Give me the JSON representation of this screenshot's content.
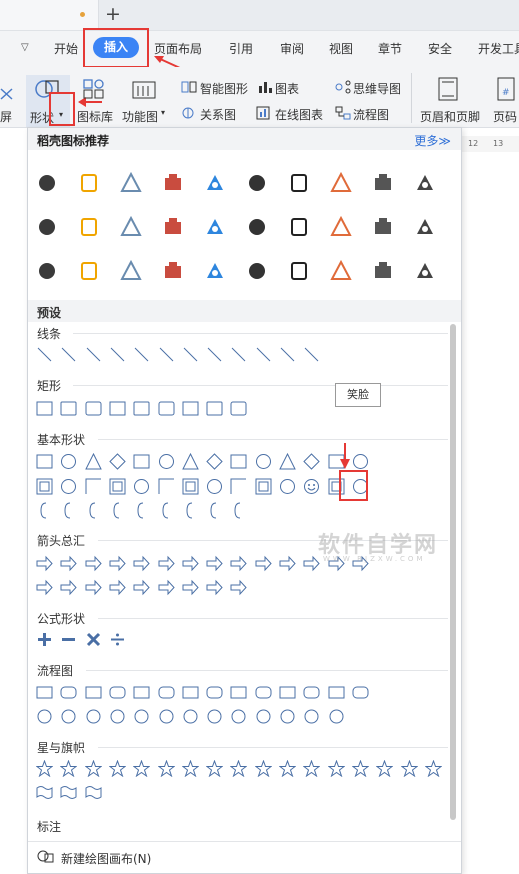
{
  "tabs": {
    "new_tab": "+"
  },
  "menu": {
    "items": [
      "开始",
      "插入",
      "页面布局",
      "引用",
      "审阅",
      "视图",
      "章节",
      "安全",
      "开发工具"
    ],
    "active": "插入",
    "dropdown": "▽",
    "accent": "#3b84f5"
  },
  "ribbon": {
    "left_cut": "屏",
    "shapes": "形状",
    "icon_lib": "图标库",
    "function_chart": "功能图",
    "smart_graphic": "智能图形",
    "chart": "图表",
    "mind_map": "思维导图",
    "relation": "关系图",
    "online_chart": "在线图表",
    "flowchart": "流程图",
    "header_footer": "页眉和页脚",
    "page_num": "页码"
  },
  "ruler": {
    "ticks": [
      "12",
      "13"
    ]
  },
  "panel": {
    "title": "稻壳图标推荐",
    "more": "更多≫",
    "recommended_icons": [
      "pushpin-icon",
      "pie-chart-icon",
      "flag-icon",
      "lightbulb-icon",
      "pen-icon",
      "trophy-icon",
      "document-icon",
      "clipboard-icon",
      "users-icon",
      "camera-icon",
      "money-icon",
      "sneaker-icon",
      "cloud-icon",
      "building-icon",
      "badge-icon",
      "hexagon-icon",
      "contact-icon",
      "gear-icon",
      "shopping-bag-icon",
      "edit-note-icon",
      "hourglass-icon",
      "sale-tag-icon",
      "board-icon",
      "tree-icon",
      "search-doc-icon",
      "cake-icon",
      "crab-icon",
      "person-icon",
      "stats-icon",
      "house-icon"
    ],
    "presets_title": "预设",
    "sections": [
      {
        "title": "线条"
      },
      {
        "title": "矩形"
      },
      {
        "title": "基本形状"
      },
      {
        "title": "箭头总汇"
      },
      {
        "title": "公式形状"
      },
      {
        "title": "流程图"
      },
      {
        "title": "星与旗帜"
      },
      {
        "title": "标注"
      }
    ],
    "tooltip": "笑脸",
    "footer": "新建绘图画布(N)",
    "watermark": "软件自学网",
    "watermark_sub": "WWW.RJZXW.COM"
  }
}
